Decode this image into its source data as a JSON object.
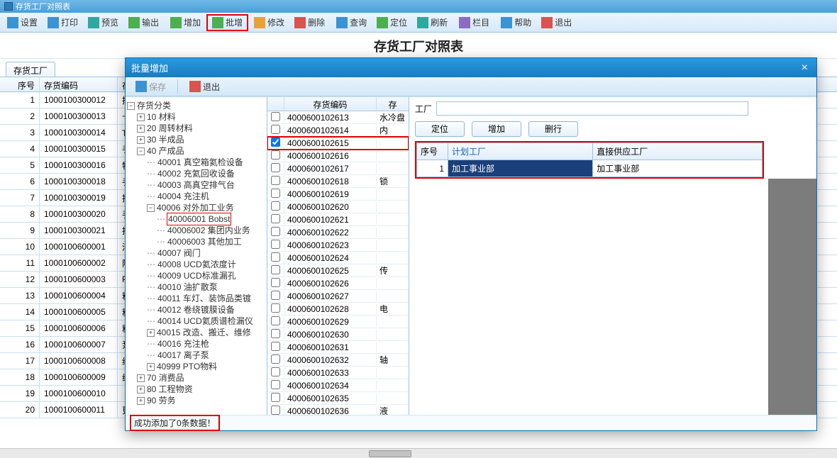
{
  "window": {
    "title": "存货工厂对照表"
  },
  "toolbar": {
    "settings": "设置",
    "print": "打印",
    "preview": "预览",
    "export": "输出",
    "add": "增加",
    "batch_add": "批增",
    "modify": "修改",
    "delete": "删除",
    "query": "查询",
    "locate": "定位",
    "refresh": "刷新",
    "columns": "栏目",
    "help": "帮助",
    "exit": "退出"
  },
  "page_title": "存货工厂对照表",
  "tab": {
    "label": "存货工厂"
  },
  "bg_table": {
    "headers": {
      "seq": "序号",
      "code": "存货编码",
      "spec": "存"
    },
    "rows": [
      {
        "seq": 1,
        "code": "1000100300012",
        "spec": "把"
      },
      {
        "seq": 2,
        "code": "1000100300013",
        "spec": "十"
      },
      {
        "seq": 3,
        "code": "1000100300014",
        "spec": "T型"
      },
      {
        "seq": 4,
        "code": "1000100300015",
        "spec": "手"
      },
      {
        "seq": 5,
        "code": "1000100300016",
        "spec": "特"
      },
      {
        "seq": 6,
        "code": "1000100300018",
        "spec": "手"
      },
      {
        "seq": 7,
        "code": "1000100300019",
        "spec": "把"
      },
      {
        "seq": 8,
        "code": "1000100300020",
        "spec": "手"
      },
      {
        "seq": 9,
        "code": "1000100300021",
        "spec": "拆"
      },
      {
        "seq": 10,
        "code": "1000100600001",
        "spec": "清"
      },
      {
        "seq": 11,
        "code": "1000100600002",
        "spec": "隆"
      },
      {
        "seq": 12,
        "code": "1000100600003",
        "spec": "PE"
      },
      {
        "seq": 13,
        "code": "1000100600004",
        "spec": "粗"
      },
      {
        "seq": 14,
        "code": "1000100600005",
        "spec": "粗"
      },
      {
        "seq": 15,
        "code": "1000100600006",
        "spec": "粗"
      },
      {
        "seq": 16,
        "code": "1000100600007",
        "spec": "泵"
      },
      {
        "seq": 17,
        "code": "1000100600008",
        "spec": "维"
      },
      {
        "seq": 18,
        "code": "1000100600009",
        "spec": "维"
      },
      {
        "seq": 19,
        "code": "1000100600010",
        "spec": ""
      },
      {
        "seq": 20,
        "code": "1000100600011",
        "spec": "更"
      }
    ]
  },
  "modal": {
    "title": "批量增加",
    "toolbar": {
      "save": "保存",
      "exit": "退出"
    },
    "status": "成功添加了0条数据！",
    "tree": {
      "root": "存货分类",
      "n10": "10 材料",
      "n20": "20 周转材料",
      "n30": "30 半成品",
      "n40": "40 产成品",
      "n40001": "40001 真空箱氦检设备",
      "n40002": "40002 充氦回收设备",
      "n40003": "40003 高真空排气台",
      "n40004": "40004 充注机",
      "n40006": "40006 对外加工业务",
      "n4000601": "40006001 Bobst",
      "n4000602": "40006002 集团内业务",
      "n4000603": "40006003 其他加工",
      "n40007": "40007 阀门",
      "n40008": "40008 UCD氦浓度计",
      "n40009": "40009 UCD标准漏孔",
      "n40010": "40010 油扩散泵",
      "n40011": "40011 车灯、装饰品类镀",
      "n40012": "40012 卷绕镀膜设备",
      "n40014": "40014 UCD氦质谱检漏仪",
      "n40015": "40015 改造、搬迁、维修",
      "n40016": "40016 充注枪",
      "n40017": "40017 离子泵",
      "n40999": "40999 PTO物料",
      "n70": "70 消费品",
      "n80": "80 工程物资",
      "n90": "90 劳务"
    },
    "list": {
      "header_code": "存货编码",
      "header_name": "存",
      "rows": [
        {
          "code": "4000600102613",
          "name": "水冷盘",
          "checked": false
        },
        {
          "code": "4000600102614",
          "name": "内",
          "checked": false
        },
        {
          "code": "4000600102615",
          "name": "",
          "checked": true,
          "hl": true
        },
        {
          "code": "4000600102616",
          "name": "",
          "checked": false
        },
        {
          "code": "4000600102617",
          "name": "",
          "checked": false
        },
        {
          "code": "4000600102618",
          "name": "锁",
          "checked": false
        },
        {
          "code": "4000600102619",
          "name": "",
          "checked": false
        },
        {
          "code": "4000600102620",
          "name": "",
          "checked": false
        },
        {
          "code": "4000600102621",
          "name": "",
          "checked": false
        },
        {
          "code": "4000600102622",
          "name": "",
          "checked": false
        },
        {
          "code": "4000600102623",
          "name": "",
          "checked": false
        },
        {
          "code": "4000600102624",
          "name": "",
          "checked": false
        },
        {
          "code": "4000600102625",
          "name": "传",
          "checked": false
        },
        {
          "code": "4000600102626",
          "name": "",
          "checked": false
        },
        {
          "code": "4000600102627",
          "name": "",
          "checked": false
        },
        {
          "code": "4000600102628",
          "name": "电",
          "checked": false
        },
        {
          "code": "4000600102629",
          "name": "",
          "checked": false
        },
        {
          "code": "4000600102630",
          "name": "",
          "checked": false
        },
        {
          "code": "4000600102631",
          "name": "",
          "checked": false
        },
        {
          "code": "4000600102632",
          "name": "轴",
          "checked": false
        },
        {
          "code": "4000600102633",
          "name": "",
          "checked": false
        },
        {
          "code": "4000600102634",
          "name": "",
          "checked": false
        },
        {
          "code": "4000600102635",
          "name": "",
          "checked": false
        },
        {
          "code": "4000600102636",
          "name": "液",
          "checked": false
        }
      ]
    },
    "right": {
      "factory_label": "工厂",
      "factory_value": "",
      "btn_locate": "定位",
      "btn_add": "增加",
      "btn_delrow": "删行",
      "table": {
        "h_seq": "序号",
        "h_plan": "计划工厂",
        "h_supply": "直接供应工厂",
        "rows": [
          {
            "seq": 1,
            "plan": "加工事业部",
            "supply": "加工事业部"
          }
        ]
      }
    }
  }
}
